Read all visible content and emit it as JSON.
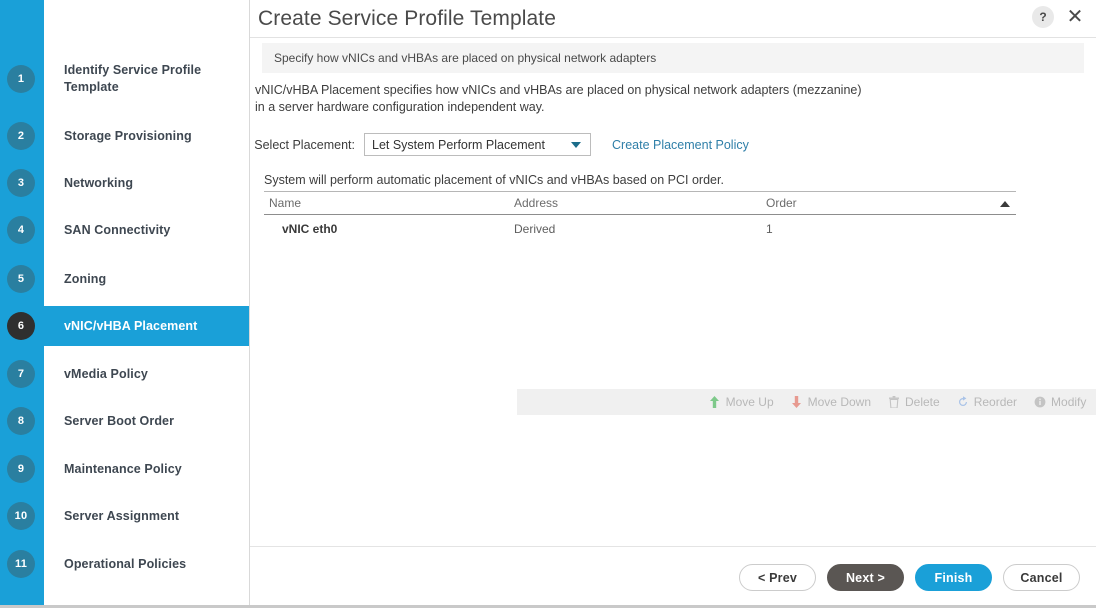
{
  "window": {
    "title": "Create Service Profile Template",
    "help_icon": "?",
    "close_icon": "✕",
    "subheader": "Specify how vNICs and vHBAs are placed on physical network adapters"
  },
  "theme": {
    "accent": "#1aa0d8",
    "rail": "#1aa0d8",
    "step_circle": "#2a7fa0",
    "step_circle_active": "#2f2f2f",
    "link": "#2f7fa8",
    "dark_button": "#5a5653"
  },
  "sidebar": {
    "items": [
      {
        "number": "1",
        "label": "Identify Service Profile Template",
        "active": false
      },
      {
        "number": "2",
        "label": "Storage Provisioning",
        "active": false
      },
      {
        "number": "3",
        "label": "Networking",
        "active": false
      },
      {
        "number": "4",
        "label": "SAN Connectivity",
        "active": false
      },
      {
        "number": "5",
        "label": "Zoning",
        "active": false
      },
      {
        "number": "6",
        "label": "vNIC/vHBA Placement",
        "active": true
      },
      {
        "number": "7",
        "label": "vMedia Policy",
        "active": false
      },
      {
        "number": "8",
        "label": "Server Boot Order",
        "active": false
      },
      {
        "number": "9",
        "label": "Maintenance Policy",
        "active": false
      },
      {
        "number": "10",
        "label": "Server Assignment",
        "active": false
      },
      {
        "number": "11",
        "label": "Operational Policies",
        "active": false
      }
    ]
  },
  "content": {
    "description_line1": "vNIC/vHBA Placement specifies how vNICs and vHBAs are placed on physical network adapters (mezzanine)",
    "description_line2": "in a server hardware configuration independent way.",
    "placement_label": "Select Placement:",
    "placement_value": "Let System Perform Placement",
    "create_policy_link": "Create Placement Policy",
    "hint": "System will perform automatic placement of vNICs and vHBAs based on PCI order."
  },
  "table": {
    "columns": [
      "Name",
      "Address",
      "Order"
    ],
    "sort_indicator": "ascending",
    "rows": [
      {
        "name": "vNIC eth0",
        "address": "Derived",
        "order": "1"
      }
    ]
  },
  "toolbar": {
    "buttons": [
      {
        "label": "Move Up",
        "icon": "arrow-up-icon",
        "color": "#7ec98a"
      },
      {
        "label": "Move Down",
        "icon": "arrow-down-icon",
        "color": "#e79a90"
      },
      {
        "label": "Delete",
        "icon": "trash-icon",
        "color": "#c4c4c4"
      },
      {
        "label": "Reorder",
        "icon": "refresh-icon",
        "color": "#a9c3e8"
      },
      {
        "label": "Modify",
        "icon": "info-circle-icon",
        "color": "#c4c4c4"
      }
    ]
  },
  "footer": {
    "prev": "< Prev",
    "next": "Next >",
    "finish": "Finish",
    "cancel": "Cancel"
  }
}
